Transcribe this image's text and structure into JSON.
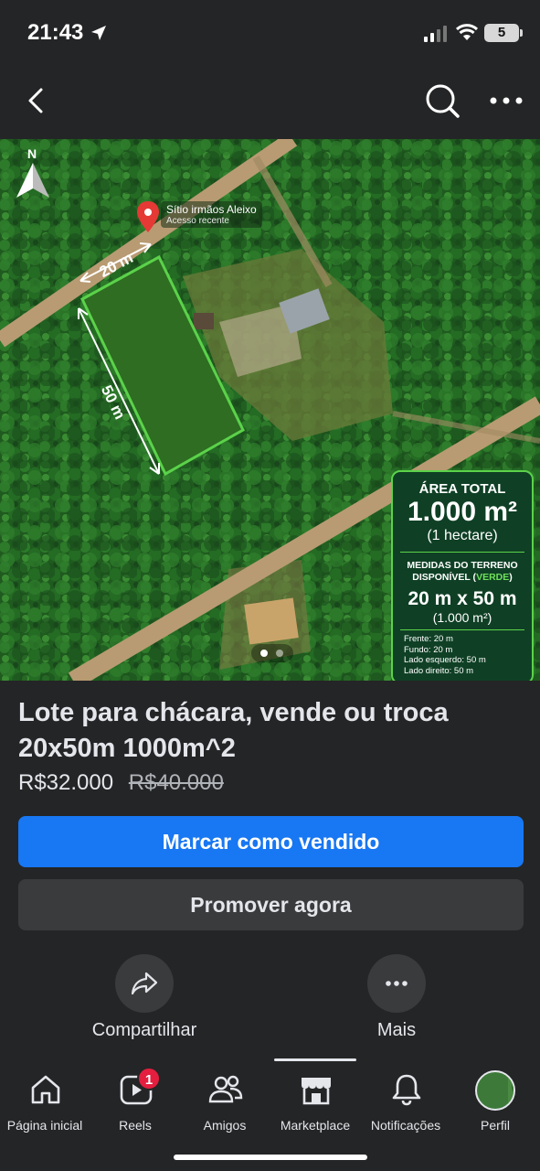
{
  "status_bar": {
    "time": "21:43",
    "battery": "5"
  },
  "listing_photo": {
    "pin_title": "Sítio irmãos Aleixo",
    "pin_subtitle": "Acesso recente",
    "compass_letter": "N",
    "dimension_front": "20 m",
    "dimension_side": "50 m",
    "info_card": {
      "area_title": "ÁREA TOTAL",
      "area_value": "1.000 m²",
      "area_sub": "(1 hectare)",
      "measures_title_1": "MEDIDAS DO TERRENO",
      "measures_title_2": "DISPONÍVEL (",
      "measures_green": "VERDE",
      "measures_title_3": ")",
      "measures_value": "20 m x 50 m",
      "measures_sub": "(1.000 m²)",
      "sides": [
        "Frente: 20 m",
        "Fundo: 20 m",
        "Lado esquerdo: 50 m",
        "Lado direito: 50 m"
      ]
    },
    "page_count": 2,
    "current_page": 1
  },
  "listing": {
    "title": "Lote para chácara, vende ou troca 20x50m 1000m^2",
    "price": "R$32.000",
    "old_price": "R$40.000"
  },
  "buttons": {
    "mark_sold": "Marcar como vendido",
    "promote": "Promover agora"
  },
  "actions": {
    "share": "Compartilhar",
    "more": "Mais"
  },
  "tab_bar": {
    "items": [
      {
        "label": "Página inicial",
        "icon": "home-icon"
      },
      {
        "label": "Reels",
        "icon": "reels-icon",
        "badge": "1"
      },
      {
        "label": "Amigos",
        "icon": "friends-icon"
      },
      {
        "label": "Marketplace",
        "icon": "marketplace-icon",
        "active": true
      },
      {
        "label": "Notificações",
        "icon": "bell-icon"
      },
      {
        "label": "Perfil",
        "icon": "avatar"
      }
    ]
  },
  "colors": {
    "background": "#242526",
    "primary_button": "#1877f2",
    "secondary_button": "#3a3b3c",
    "badge": "#e41e3f",
    "plot_outline": "#5bd24a"
  }
}
